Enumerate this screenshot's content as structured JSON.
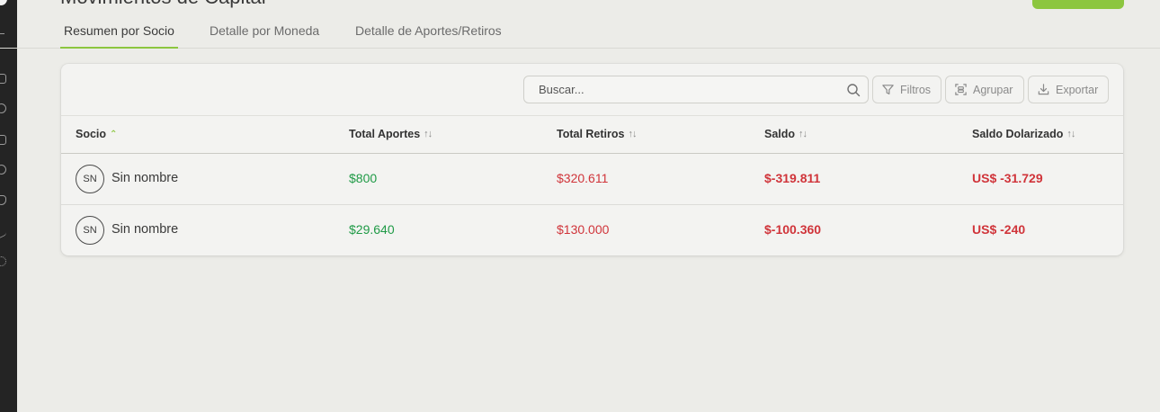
{
  "header": {
    "title": "Movimientos de Capital"
  },
  "tabs": [
    {
      "label": "Resumen por Socio",
      "active": true
    },
    {
      "label": "Detalle por Moneda",
      "active": false
    },
    {
      "label": "Detalle de Aportes/Retiros",
      "active": false
    }
  ],
  "toolbar": {
    "search_placeholder": "Buscar...",
    "filter_label": "Filtros",
    "group_label": "Agrupar",
    "export_label": "Exportar"
  },
  "table": {
    "columns": [
      "Socio",
      "Total Aportes",
      "Total Retiros",
      "Saldo",
      "Saldo Dolarizado"
    ],
    "sorted_column": "Socio",
    "rows": [
      {
        "initials": "SN",
        "socio": "Sin nombre",
        "aportes": "$800",
        "retiros": "$320.611",
        "saldo": "$-319.811",
        "saldo_dolarizado": "US$ -31.729"
      },
      {
        "initials": "SN",
        "socio": "Sin nombre",
        "aportes": "$29.640",
        "retiros": "$130.000",
        "saldo": "$-100.360",
        "saldo_dolarizado": "US$ -240"
      }
    ]
  },
  "colors": {
    "accent": "#8cc63f",
    "positive": "#1f9a46",
    "negative": "#d0343a",
    "sidebar": "#242424",
    "background": "#ecece8"
  },
  "icons": {
    "search": "search-icon",
    "filter": "filter-icon",
    "group": "group-icon",
    "export": "download-icon",
    "sort": "sort-icon",
    "sort_asc": "chevron-up-icon"
  }
}
